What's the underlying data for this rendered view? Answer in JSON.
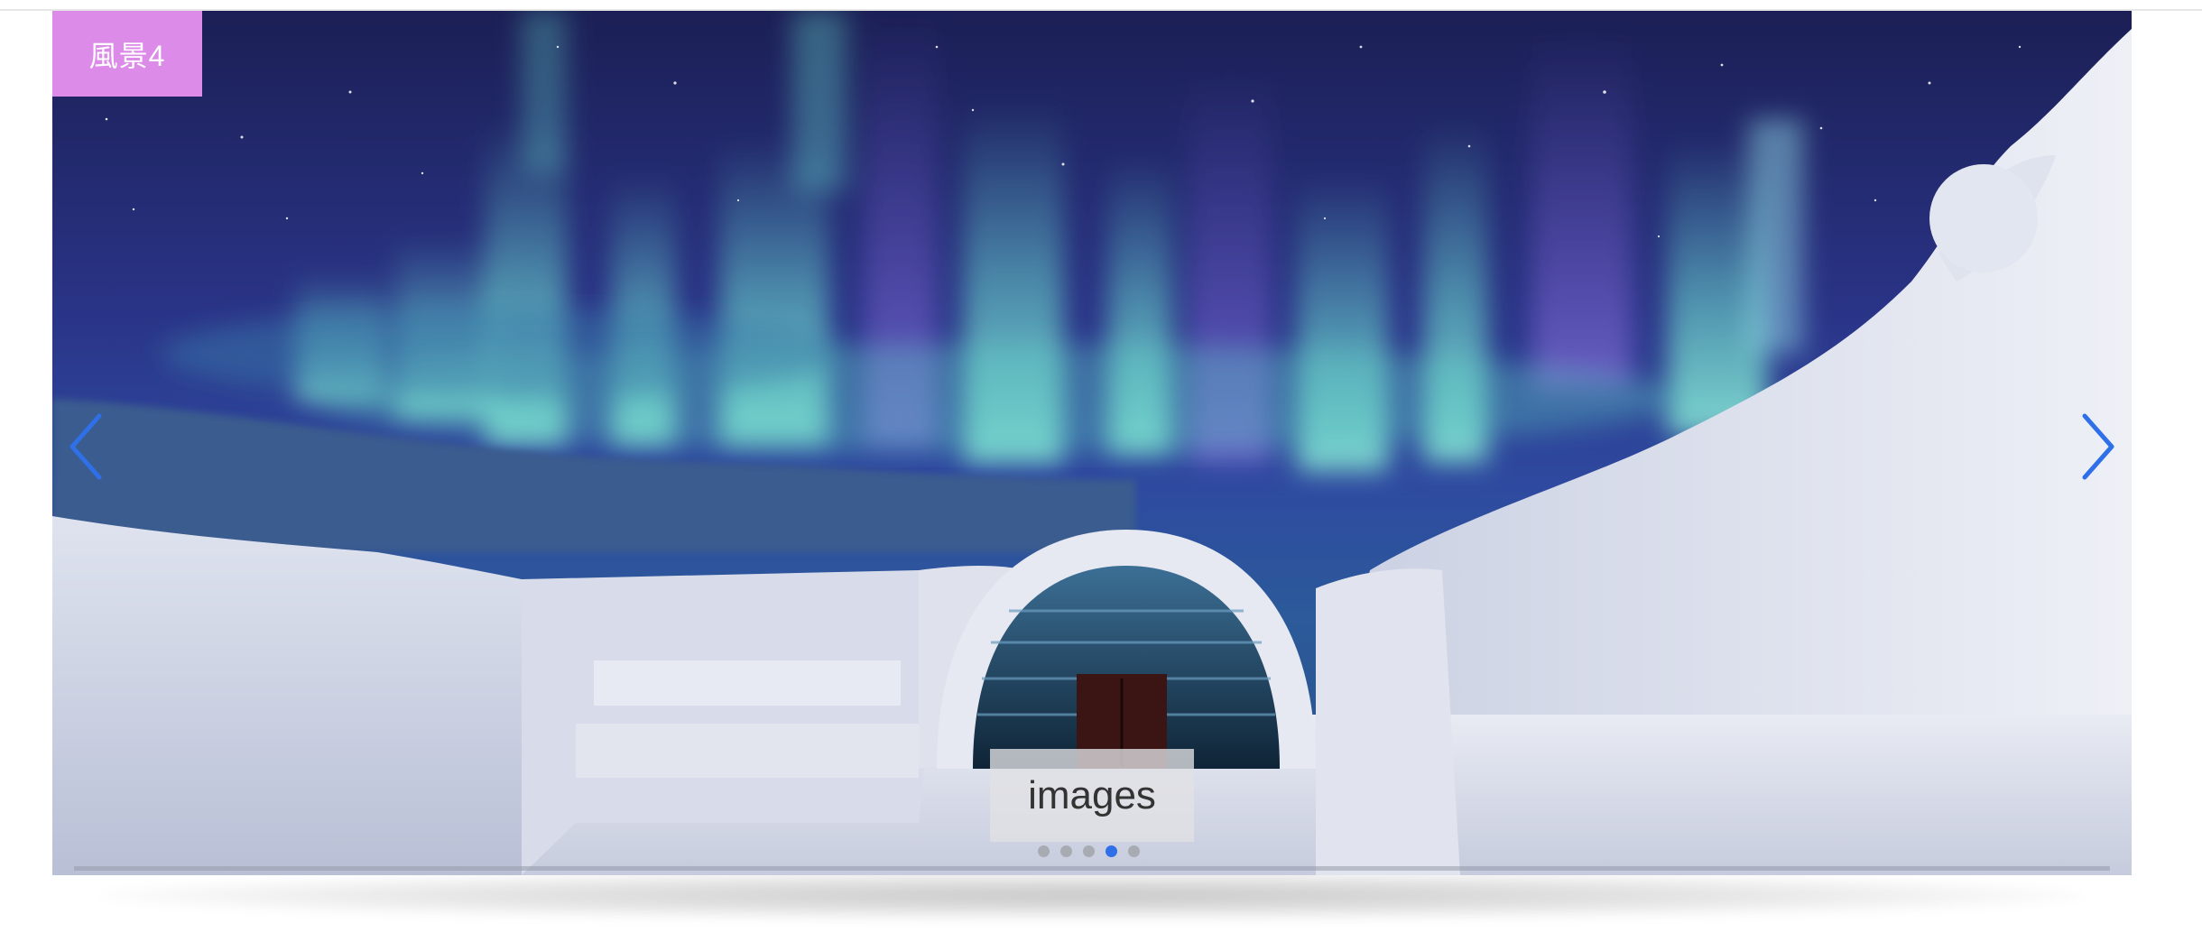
{
  "slide": {
    "title": "風景4",
    "caption": "images",
    "image_alt": "aurora-over-ice-hotel"
  },
  "controls": {
    "prev_icon": "chevron-left-icon",
    "next_icon": "chevron-right-icon"
  },
  "pagination": {
    "total": 5,
    "active_index": 4
  },
  "colors": {
    "badge": "#dc8ce8",
    "accent": "#2f6fe8",
    "dot_inactive": "#a9abb3"
  }
}
